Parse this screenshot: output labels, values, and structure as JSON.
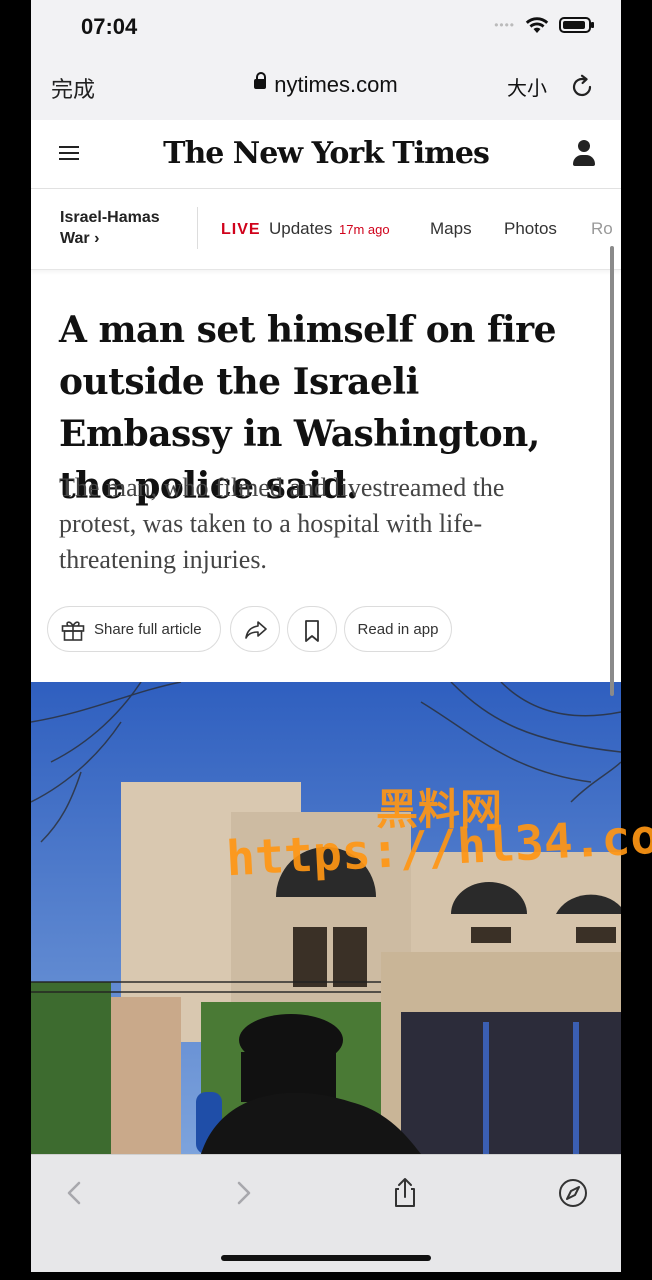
{
  "status": {
    "time": "07:04"
  },
  "browser": {
    "done_label": "完成",
    "url": "nytimes.com",
    "text_size_label": "大小"
  },
  "nyt": {
    "logo": "The New York Times",
    "subnav": {
      "topic_line1": "Israel-Hamas",
      "topic_line2": "War ›",
      "live_label": "LIVE",
      "updates_label": "Updates",
      "updated_ago": "17m ago",
      "maps_label": "Maps",
      "photos_label": "Photos",
      "more_label": "Ro"
    }
  },
  "article": {
    "headline": "A man set himself on fire outside the Israeli Embassy in Washington, the police said.",
    "summary": "The man, who filmed and livestreamed the protest, was taken to a hospital with life-threatening injuries.",
    "share_full_label": "Share full article",
    "read_in_app_label": "Read in app"
  },
  "watermark": {
    "line1": "黑料网",
    "line2": "https://hl34.co"
  },
  "colors": {
    "live_red": "#d0021b",
    "watermark_orange": "#ff9614"
  }
}
